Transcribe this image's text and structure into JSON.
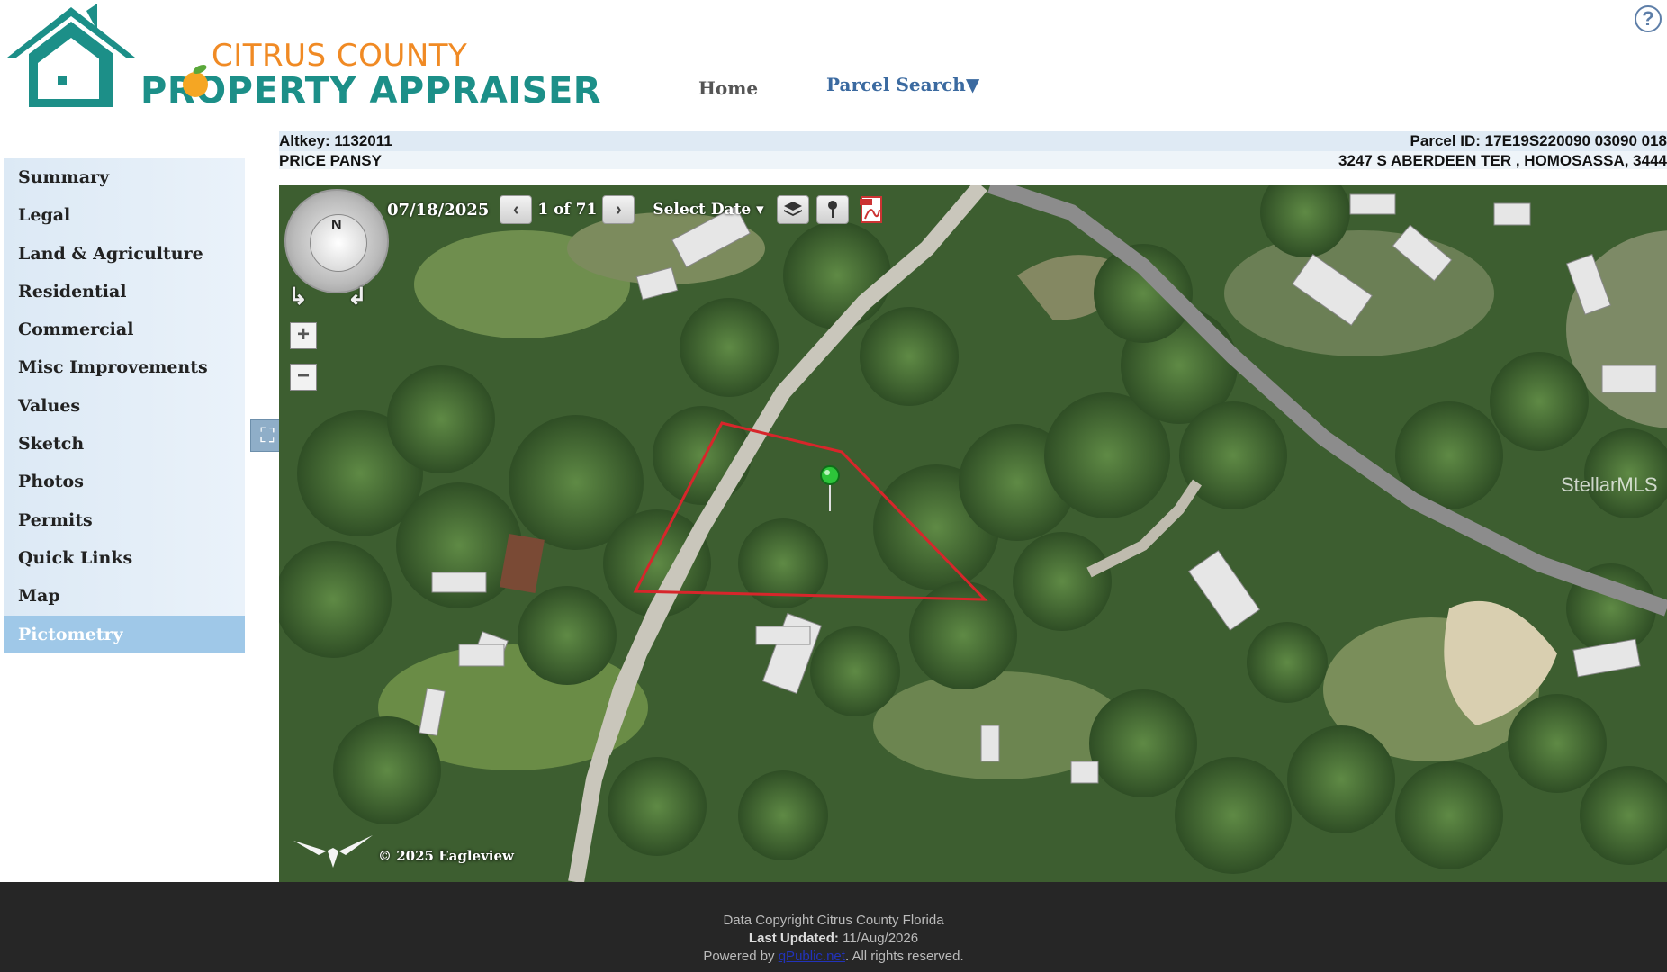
{
  "header": {
    "logo_line1": "CITRUS COUNTY",
    "logo_line2": "PROPERTY APPRAISER",
    "nav_home": "Home",
    "nav_parcel_search": "Parcel Search▼",
    "help": "?"
  },
  "colors": {
    "logo_teal": "#1c8f88",
    "logo_orange": "#f08a24",
    "sidebar_bg": "#dce9f5",
    "sidebar_active": "#9fc8e8",
    "footer_bg": "#262626"
  },
  "info": {
    "altkey": "Altkey: 1132011",
    "parcel_id": "Parcel ID: 17E19S220090 03090 018",
    "owner": "PRICE PANSY",
    "address": "3247 S ABERDEEN TER , HOMOSASSA, 3444"
  },
  "sidebar": {
    "items": [
      {
        "label": "Summary"
      },
      {
        "label": "Legal"
      },
      {
        "label": "Land & Agriculture"
      },
      {
        "label": "Residential"
      },
      {
        "label": "Commercial"
      },
      {
        "label": "Misc Improvements"
      },
      {
        "label": "Values"
      },
      {
        "label": "Sketch"
      },
      {
        "label": "Photos"
      },
      {
        "label": "Permits"
      },
      {
        "label": "Quick Links"
      },
      {
        "label": "Map"
      },
      {
        "label": "Pictometry"
      }
    ],
    "active": "Pictometry"
  },
  "map": {
    "date": "07/18/2025",
    "image_count": "1 of 71",
    "select_date": "Select Date ▾",
    "compass_n": "N",
    "zoom_in": "+",
    "zoom_out": "−",
    "copyright": "© 2025 Eagleview",
    "watermark": "StellarMLS",
    "icons": [
      "compass-icon",
      "prev-icon",
      "next-icon",
      "layers-icon",
      "pin-icon",
      "pdf-icon",
      "fullscreen-icon",
      "eagle-logo-icon",
      "location-marker-icon"
    ]
  },
  "footer": {
    "line1": "Data Copyright Citrus County Florida",
    "last_updated_label": "Last Updated:",
    "last_updated_value": "11/Aug/2026",
    "powered_by": "Powered by",
    "powered_link": "qPublic.net",
    "rights": ". All rights reserved."
  }
}
